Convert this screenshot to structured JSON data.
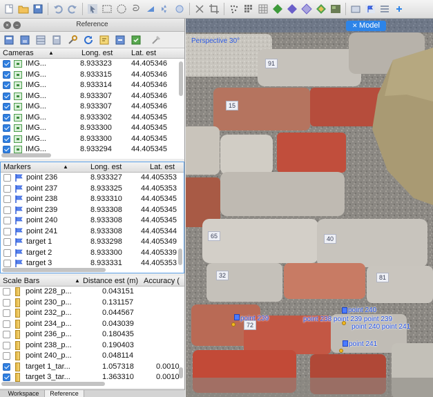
{
  "panel": {
    "title": "Reference"
  },
  "viewport": {
    "tab_label": "Model",
    "perspective_label": "Perspective 30°"
  },
  "cameras": {
    "headers": [
      "Cameras",
      "Long. est",
      "Lat. est"
    ],
    "rows": [
      {
        "label": "IMG...",
        "long": "8.933323",
        "lat": "44.405346"
      },
      {
        "label": "IMG...",
        "long": "8.933315",
        "lat": "44.405346"
      },
      {
        "label": "IMG...",
        "long": "8.933314",
        "lat": "44.405346"
      },
      {
        "label": "IMG...",
        "long": "8.933307",
        "lat": "44.405346"
      },
      {
        "label": "IMG...",
        "long": "8.933307",
        "lat": "44.405346"
      },
      {
        "label": "IMG...",
        "long": "8.933302",
        "lat": "44.405345"
      },
      {
        "label": "IMG...",
        "long": "8.933300",
        "lat": "44.405345"
      },
      {
        "label": "IMG...",
        "long": "8.933300",
        "lat": "44.405345"
      },
      {
        "label": "IMG...",
        "long": "8.933294",
        "lat": "44.405345"
      }
    ]
  },
  "markers": {
    "headers": [
      "Markers",
      "Long. est",
      "Lat. est"
    ],
    "rows": [
      {
        "label": "point 236",
        "long": "8.933327",
        "lat": "44.405353"
      },
      {
        "label": "point 237",
        "long": "8.933325",
        "lat": "44.405353"
      },
      {
        "label": "point 238",
        "long": "8.933310",
        "lat": "44.405345"
      },
      {
        "label": "point 239",
        "long": "8.933308",
        "lat": "44.405345"
      },
      {
        "label": "point 240",
        "long": "8.933308",
        "lat": "44.405345"
      },
      {
        "label": "point 241",
        "long": "8.933308",
        "lat": "44.405344"
      },
      {
        "label": "target 1",
        "long": "8.933298",
        "lat": "44.405349"
      },
      {
        "label": "target 2",
        "long": "8.933300",
        "lat": "44.405339"
      },
      {
        "label": "target 3",
        "long": "8.933331",
        "lat": "44.405353"
      }
    ]
  },
  "scalebars": {
    "headers": [
      "Scale Bars",
      "Distance est (m)",
      "Accuracy ("
    ],
    "rows": [
      {
        "label": "point 228_p...",
        "dist": "0.043151",
        "acc": "",
        "checked": false
      },
      {
        "label": "point 230_p...",
        "dist": "0.131157",
        "acc": "",
        "checked": false
      },
      {
        "label": "point 232_p...",
        "dist": "0.044567",
        "acc": "",
        "checked": false
      },
      {
        "label": "point 234_p...",
        "dist": "0.043039",
        "acc": "",
        "checked": false
      },
      {
        "label": "point 236_p...",
        "dist": "0.180435",
        "acc": "",
        "checked": false
      },
      {
        "label": "point 238_p...",
        "dist": "0.190403",
        "acc": "",
        "checked": false
      },
      {
        "label": "point 240_p...",
        "dist": "0.048114",
        "acc": "",
        "checked": false
      },
      {
        "label": "target 1_tar...",
        "dist": "1.057318",
        "acc": "0.0010",
        "checked": true
      },
      {
        "label": "target 3_tar...",
        "dist": "1.363310",
        "acc": "0.0010",
        "checked": true
      }
    ]
  },
  "tabs": [
    "Workspace",
    "Reference"
  ],
  "brick_labels": [
    "91",
    "15",
    "65",
    "40",
    "32",
    "81",
    "72"
  ],
  "point_labels": {
    "p240": "point 240",
    "p239": "point 239",
    "p238": "point 238",
    "p241": "point 241",
    "cluster": "point 238 point 239 point 239",
    "cluster2": "point 240 point 241"
  },
  "colors": {
    "accent": "#2d84e8",
    "marker_text": "#2452e6",
    "checkbox_on": "#2f7fe0"
  }
}
